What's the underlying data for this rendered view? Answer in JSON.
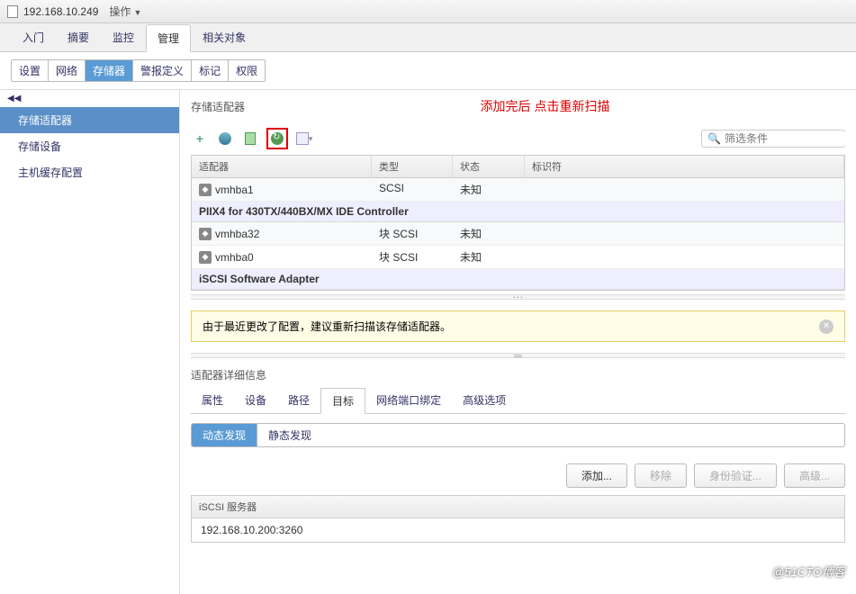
{
  "titlebar": {
    "ip": "192.168.10.249",
    "actions": "操作"
  },
  "mainTabs": [
    "入门",
    "摘要",
    "监控",
    "管理",
    "相关对象"
  ],
  "mainActive": 3,
  "subTabs": [
    "设置",
    "网络",
    "存储器",
    "警报定义",
    "标记",
    "权限"
  ],
  "subActive": 2,
  "sidebar": {
    "items": [
      "存储适配器",
      "存储设备",
      "主机缓存配置"
    ],
    "active": 0
  },
  "panel": {
    "title": "存储适配器",
    "annotation": "添加完后 点击重新扫描",
    "filterPlaceholder": "筛选条件"
  },
  "gridHeaders": {
    "adapter": "适配器",
    "type": "类型",
    "status": "状态",
    "id": "标识符"
  },
  "rows": [
    {
      "name": "vmhba1",
      "type": "SCSI",
      "status": "未知"
    },
    {
      "group": "PIIX4 for 430TX/440BX/MX IDE Controller"
    },
    {
      "name": "vmhba32",
      "type": "块 SCSI",
      "status": "未知"
    },
    {
      "name": "vmhba0",
      "type": "块 SCSI",
      "status": "未知"
    },
    {
      "group": "iSCSI Software Adapter"
    }
  ],
  "warning": "由于最近更改了配置，建议重新扫描该存储适配器。",
  "detail": {
    "title": "适配器详细信息",
    "tabs": [
      "属性",
      "设备",
      "路径",
      "目标",
      "网络端口绑定",
      "高级选项"
    ],
    "active": 3
  },
  "discovery": {
    "tabs": [
      "动态发现",
      "静态发现"
    ],
    "active": 0
  },
  "buttons": {
    "add": "添加...",
    "remove": "移除",
    "auth": "身份验证...",
    "adv": "高级..."
  },
  "serverGrid": {
    "header": "iSCSI 服务器",
    "row": "192.168.10.200:3260"
  },
  "watermark": "@51CTO博客"
}
